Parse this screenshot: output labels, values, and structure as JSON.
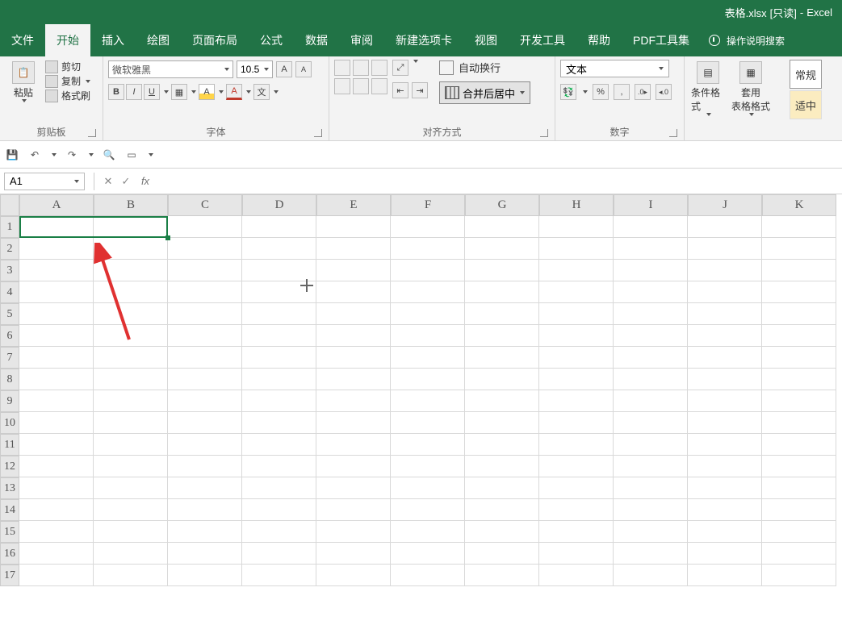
{
  "title": {
    "filename": "表格.xlsx",
    "mode": "[只读]",
    "dash": "-",
    "app": "Excel"
  },
  "menu": {
    "items": [
      "文件",
      "开始",
      "插入",
      "绘图",
      "页面布局",
      "公式",
      "数据",
      "审阅",
      "新建选项卡",
      "视图",
      "开发工具",
      "帮助",
      "PDF工具集"
    ],
    "active_index": 1,
    "tell_me": "操作说明搜索"
  },
  "ribbon": {
    "clipboard": {
      "label": "剪贴板",
      "paste": "粘贴",
      "cut": "剪切",
      "copy": "复制",
      "painter": "格式刷"
    },
    "font": {
      "label": "字体",
      "name": "微软雅黑",
      "size": "10.5",
      "bold": "B",
      "italic": "I",
      "underline": "U"
    },
    "alignment": {
      "label": "对齐方式",
      "wrap": "自动换行",
      "merge": "合并后居中"
    },
    "number": {
      "label": "数字",
      "format": "文本",
      "percent": "%",
      "comma": ","
    },
    "styles": {
      "cond": "条件格式",
      "table": "套用\n表格格式",
      "cell_style": "常规",
      "good": "适中"
    }
  },
  "formula_bar": {
    "name_box": "A1",
    "cancel": "✕",
    "enter": "✓",
    "fx": "fx"
  },
  "grid": {
    "columns": [
      "A",
      "B",
      "C",
      "D",
      "E",
      "F",
      "G",
      "H",
      "I",
      "J",
      "K"
    ],
    "rows": [
      1,
      2,
      3,
      4,
      5,
      6,
      7,
      8,
      9,
      10,
      11,
      12,
      13,
      14,
      15,
      16,
      17
    ],
    "selection": "A1:B1"
  }
}
